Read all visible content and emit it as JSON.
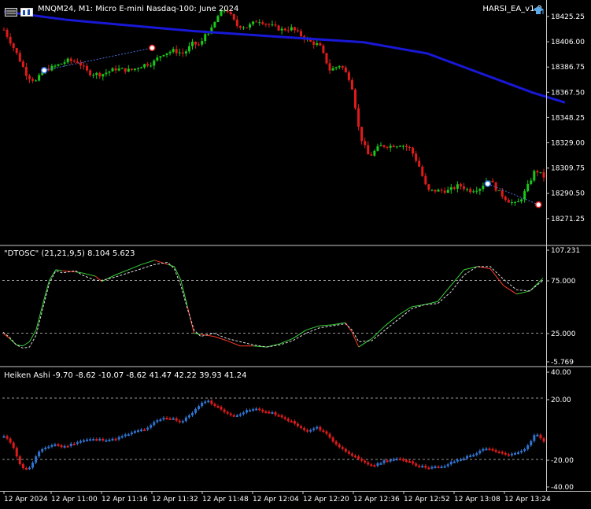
{
  "chart_window": {
    "symbol_title": "MNQM24, M1:  Micro E-mini Nasdaq-100: June 2024",
    "expert_name": "HARSI_EA_v1.2",
    "colors": {
      "background": "#000000",
      "bull": "#19c819",
      "bear": "#e01b1b",
      "ma": "#1818d6",
      "grid": "#c8c8c8",
      "ha_bull": "#2f74d0",
      "ha_bear": "#e01b1b"
    }
  },
  "main_pane": {
    "price_ticks": [
      "18425.25",
      "18406.00",
      "18386.75",
      "18367.50",
      "18348.25",
      "18329.00",
      "18309.75",
      "18290.50",
      "18271.25"
    ]
  },
  "dtosc_pane": {
    "title": "\"DTOSC\" (21,21,9,5) 8.104 5.623",
    "ticks": [
      "107.231",
      "75.000",
      "25.000",
      "-5.769"
    ]
  },
  "heiken_pane": {
    "title": "Heiken Ashi -9.70 -8.62 -10.07 -8.62 41.47 42.22 39.93 41.24",
    "ticks": [
      "40.00",
      "20.00",
      "-20.00",
      "-40.00"
    ]
  },
  "time_axis": [
    "12 Apr 2024",
    "12 Apr 11:00",
    "12 Apr 11:16",
    "12 Apr 11:32",
    "12 Apr 11:48",
    "12 Apr 12:04",
    "12 Apr 12:20",
    "12 Apr 12:36",
    "12 Apr 12:52",
    "12 Apr 13:08",
    "12 Apr 13:24"
  ],
  "chart_data": [
    {
      "type": "candlestick",
      "title": "MNQM24, M1:  Micro E-mini Nasdaq-100: June 2024",
      "ylim": [
        18262,
        18434
      ],
      "close_path_points": [
        [
          0,
          18415
        ],
        [
          12,
          18398
        ],
        [
          22,
          18382
        ],
        [
          30,
          18378
        ],
        [
          38,
          18386
        ],
        [
          52,
          18390
        ],
        [
          60,
          18393
        ],
        [
          70,
          18392
        ],
        [
          80,
          18384
        ],
        [
          92,
          18383
        ],
        [
          105,
          18387
        ],
        [
          120,
          18386
        ],
        [
          132,
          18390
        ],
        [
          140,
          18391
        ],
        [
          150,
          18398
        ],
        [
          160,
          18400
        ],
        [
          170,
          18398
        ],
        [
          178,
          18405
        ],
        [
          186,
          18404
        ],
        [
          190,
          18412
        ],
        [
          196,
          18415
        ],
        [
          203,
          18426
        ],
        [
          210,
          18430
        ],
        [
          220,
          18418
        ],
        [
          230,
          18417
        ],
        [
          240,
          18422
        ],
        [
          252,
          18418
        ],
        [
          262,
          18415
        ],
        [
          272,
          18416
        ],
        [
          282,
          18410
        ],
        [
          290,
          18406
        ],
        [
          298,
          18404
        ],
        [
          308,
          18386
        ],
        [
          318,
          18390
        ],
        [
          328,
          18378
        ],
        [
          332,
          18360
        ],
        [
          336,
          18340
        ],
        [
          345,
          18324
        ],
        [
          355,
          18332
        ],
        [
          365,
          18332
        ],
        [
          375,
          18333
        ],
        [
          384,
          18330
        ],
        [
          392,
          18318
        ],
        [
          400,
          18300
        ],
        [
          410,
          18300
        ],
        [
          420,
          18300
        ],
        [
          430,
          18304
        ],
        [
          440,
          18300
        ],
        [
          450,
          18302
        ],
        [
          458,
          18309
        ],
        [
          466,
          18300
        ],
        [
          476,
          18293
        ],
        [
          484,
          18290
        ],
        [
          490,
          18296
        ],
        [
          496,
          18305
        ],
        [
          502,
          18315
        ],
        [
          510,
          18310
        ]
      ],
      "moving_average": [
        [
          0,
          18428
        ],
        [
          60,
          18422
        ],
        [
          120,
          18418
        ],
        [
          180,
          18414
        ],
        [
          260,
          18410
        ],
        [
          340,
          18406
        ],
        [
          400,
          18398
        ],
        [
          450,
          18384
        ],
        [
          500,
          18370
        ],
        [
          530,
          18363
        ]
      ],
      "signal_markers": [
        {
          "type": "buy",
          "x": 38,
          "price": 18386
        },
        {
          "type": "sell",
          "x": 140,
          "price": 18402
        },
        {
          "type": "buy",
          "x": 457,
          "price": 18305
        },
        {
          "type": "sell",
          "x": 505,
          "price": 18290
        }
      ]
    },
    {
      "type": "line",
      "title": "\"DTOSC\" (21,21,9,5) 8.104 5.623",
      "ylim": [
        -5.769,
        107.231
      ],
      "levels": [
        75,
        25
      ],
      "series": [
        {
          "values": [
            [
              0,
              25
            ],
            [
              5,
              20
            ],
            [
              10,
              14
            ],
            [
              15,
              13
            ],
            [
              20,
              17
            ],
            [
              25,
              28
            ],
            [
              30,
              52
            ],
            [
              35,
              75
            ],
            [
              40,
              85
            ],
            [
              45,
              84
            ],
            [
              55,
              83
            ],
            [
              60,
              82
            ],
            [
              70,
              79
            ],
            [
              75,
              74
            ],
            [
              85,
              80
            ],
            [
              95,
              85
            ],
            [
              105,
              90
            ],
            [
              115,
              94
            ],
            [
              125,
              90
            ],
            [
              130,
              88
            ],
            [
              135,
              75
            ],
            [
              140,
              50
            ],
            [
              145,
              25
            ],
            [
              150,
              24
            ],
            [
              160,
              22
            ],
            [
              170,
              18
            ],
            [
              180,
              13
            ],
            [
              190,
              13
            ],
            [
              200,
              12
            ],
            [
              210,
              15
            ],
            [
              220,
              20
            ],
            [
              230,
              28
            ],
            [
              240,
              32
            ],
            [
              250,
              33
            ],
            [
              260,
              35
            ],
            [
              265,
              26
            ],
            [
              270,
              12
            ],
            [
              280,
              20
            ],
            [
              290,
              32
            ],
            [
              300,
              42
            ],
            [
              310,
              50
            ],
            [
              320,
              52
            ],
            [
              330,
              55
            ],
            [
              340,
              70
            ],
            [
              350,
              85
            ],
            [
              360,
              88
            ],
            [
              370,
              86
            ],
            [
              380,
              70
            ],
            [
              390,
              62
            ],
            [
              400,
              65
            ],
            [
              410,
              77
            ]
          ]
        },
        {
          "values": [
            [
              0,
              26
            ],
            [
              5,
              21
            ],
            [
              10,
              14
            ],
            [
              15,
              11
            ],
            [
              20,
              12
            ],
            [
              25,
              23
            ],
            [
              30,
              48
            ],
            [
              35,
              72
            ],
            [
              40,
              84
            ],
            [
              45,
              82
            ],
            [
              55,
              84
            ],
            [
              60,
              80
            ],
            [
              70,
              75
            ],
            [
              75,
              75
            ],
            [
              85,
              78
            ],
            [
              95,
              82
            ],
            [
              105,
              86
            ],
            [
              115,
              90
            ],
            [
              125,
              92
            ],
            [
              130,
              86
            ],
            [
              135,
              70
            ],
            [
              140,
              48
            ],
            [
              145,
              28
            ],
            [
              150,
              22
            ],
            [
              160,
              25
            ],
            [
              170,
              20
            ],
            [
              180,
              17
            ],
            [
              190,
              14
            ],
            [
              200,
              12
            ],
            [
              210,
              14
            ],
            [
              220,
              18
            ],
            [
              230,
              25
            ],
            [
              240,
              30
            ],
            [
              250,
              32
            ],
            [
              260,
              34
            ],
            [
              265,
              28
            ],
            [
              270,
              17
            ],
            [
              280,
              18
            ],
            [
              290,
              28
            ],
            [
              300,
              38
            ],
            [
              310,
              48
            ],
            [
              320,
              52
            ],
            [
              330,
              53
            ],
            [
              340,
              64
            ],
            [
              350,
              80
            ],
            [
              360,
              88
            ],
            [
              370,
              88
            ],
            [
              380,
              76
            ],
            [
              390,
              66
            ],
            [
              400,
              65
            ],
            [
              410,
              75
            ]
          ]
        }
      ]
    },
    {
      "type": "bar",
      "title": "Heiken Ashi -9.70 -8.62 -10.07 -8.62 41.47 42.22 39.93 41.24",
      "ylim": [
        -40,
        40
      ],
      "levels": [
        20,
        -20
      ],
      "values": [
        [
          0,
          -5
        ],
        [
          8,
          -10
        ],
        [
          16,
          -25
        ],
        [
          24,
          -26
        ],
        [
          32,
          -16
        ],
        [
          40,
          -12
        ],
        [
          48,
          -10
        ],
        [
          56,
          -12
        ],
        [
          64,
          -10
        ],
        [
          72,
          -8
        ],
        [
          80,
          -7
        ],
        [
          88,
          -7
        ],
        [
          96,
          -7
        ],
        [
          104,
          -7
        ],
        [
          112,
          -5
        ],
        [
          120,
          -3
        ],
        [
          128,
          -1
        ],
        [
          136,
          0
        ],
        [
          144,
          5
        ],
        [
          152,
          7
        ],
        [
          160,
          7
        ],
        [
          168,
          4
        ],
        [
          176,
          9
        ],
        [
          184,
          14
        ],
        [
          192,
          19
        ],
        [
          200,
          15
        ],
        [
          208,
          12
        ],
        [
          216,
          8
        ],
        [
          224,
          10
        ],
        [
          232,
          12
        ],
        [
          240,
          13
        ],
        [
          248,
          11
        ],
        [
          256,
          10
        ],
        [
          264,
          7
        ],
        [
          272,
          5
        ],
        [
          280,
          1
        ],
        [
          288,
          -2
        ],
        [
          296,
          1
        ],
        [
          304,
          -2
        ],
        [
          312,
          -8
        ],
        [
          320,
          -13
        ],
        [
          328,
          -16
        ],
        [
          336,
          -20
        ],
        [
          344,
          -23
        ],
        [
          352,
          -24
        ],
        [
          360,
          -21
        ],
        [
          368,
          -20
        ],
        [
          376,
          -20
        ],
        [
          384,
          -21
        ],
        [
          392,
          -24
        ],
        [
          400,
          -25
        ],
        [
          408,
          -25
        ],
        [
          416,
          -25
        ],
        [
          424,
          -22
        ],
        [
          432,
          -20
        ],
        [
          440,
          -18
        ],
        [
          448,
          -16
        ],
        [
          456,
          -13
        ],
        [
          464,
          -14
        ],
        [
          472,
          -16
        ],
        [
          480,
          -17
        ],
        [
          488,
          -15
        ],
        [
          496,
          -12
        ],
        [
          504,
          -3
        ],
        [
          512,
          -8
        ]
      ]
    }
  ]
}
